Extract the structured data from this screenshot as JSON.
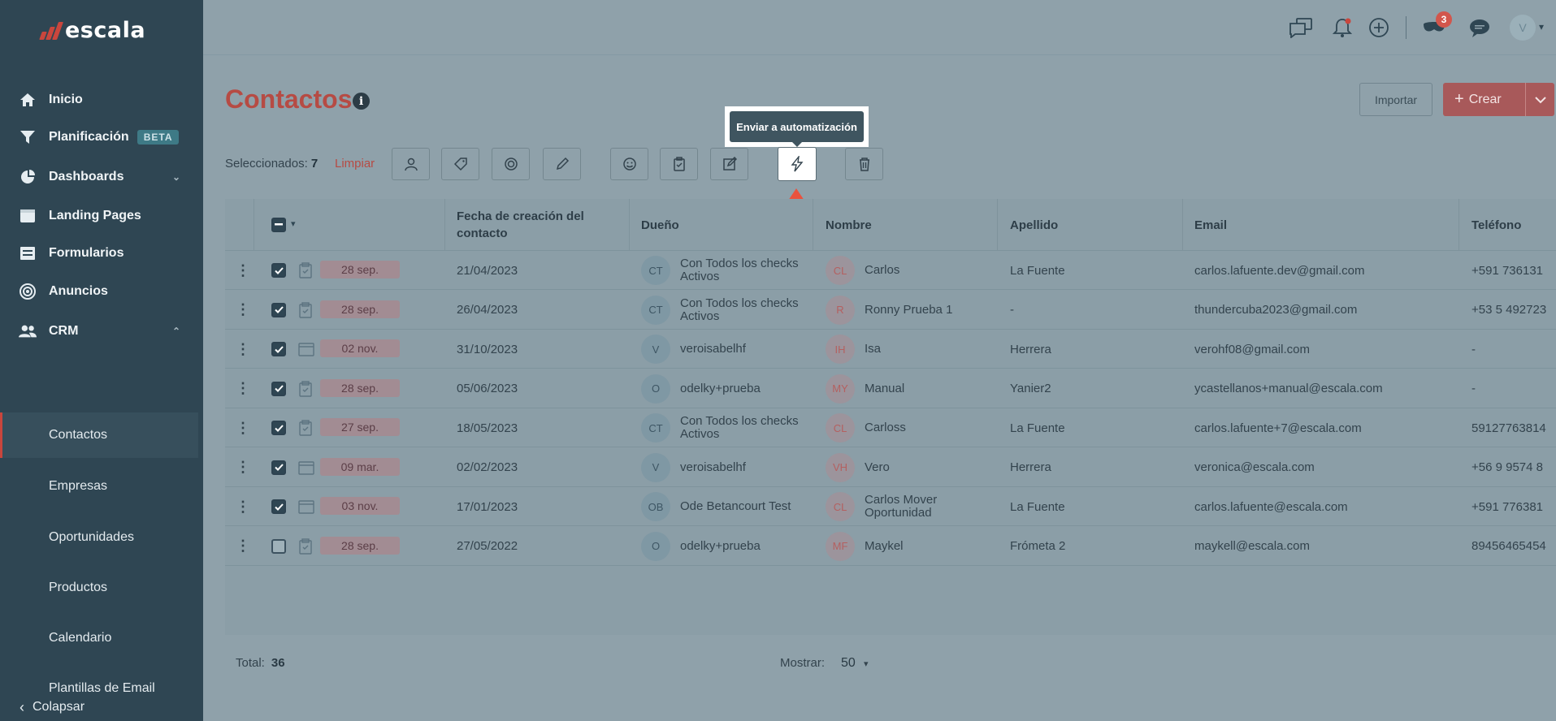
{
  "app": {
    "logo": "escala",
    "brand_color": "#c9463d"
  },
  "sidebar": {
    "items": [
      {
        "label": "Inicio",
        "icon": "home-icon"
      },
      {
        "label": "Planificación",
        "icon": "filter-icon",
        "badge": "BETA"
      },
      {
        "label": "Dashboards",
        "icon": "pie-chart-icon"
      },
      {
        "label": "Landing Pages",
        "icon": "browser-icon"
      },
      {
        "label": "Formularios",
        "icon": "form-icon"
      },
      {
        "label": "Anuncios",
        "icon": "target-icon"
      },
      {
        "label": "CRM",
        "icon": "users-icon"
      }
    ],
    "crm_subitems": [
      "Contactos",
      "Empresas",
      "Oportunidades",
      "Productos",
      "Calendario",
      "Plantillas de Email"
    ],
    "collapse_label": "Colapsar"
  },
  "topbar": {
    "notifications_badge": "3",
    "avatar_initial": "V"
  },
  "page": {
    "title": "Contactos",
    "import_label": "Importar",
    "create_label": "Crear"
  },
  "selection": {
    "label": "Seleccionados:",
    "count": "7",
    "clear_label": "Limpiar",
    "tooltip": "Enviar a automatización"
  },
  "table": {
    "headers": [
      "Fecha de creación del contacto",
      "Dueño",
      "Nombre",
      "Apellido",
      "Email",
      "Teléfono"
    ],
    "rows": [
      {
        "checked": true,
        "task": "clipboard-icon",
        "date": "28 sep.",
        "created": "21/04/2023",
        "owner_initials": "CT",
        "owner": "Con Todos los checks Activos",
        "name_initials": "CL",
        "name": "Carlos",
        "last": "La Fuente",
        "email": "carlos.lafuente.dev@gmail.com",
        "phone": "+591 736131"
      },
      {
        "checked": true,
        "task": "clipboard-icon",
        "date": "28 sep.",
        "created": "26/04/2023",
        "owner_initials": "CT",
        "owner": "Con Todos los checks Activos",
        "name_initials": "R",
        "name": "Ronny Prueba 1",
        "last": "-",
        "email": "thundercuba2023@gmail.com",
        "phone": "+53 5 492723"
      },
      {
        "checked": true,
        "task": "calendar-icon",
        "date": "02 nov.",
        "created": "31/10/2023",
        "owner_initials": "V",
        "owner": "veroisabelhf",
        "name_initials": "IH",
        "name": "Isa",
        "last": "Herrera",
        "email": "verohf08@gmail.com",
        "phone": "-"
      },
      {
        "checked": true,
        "task": "clipboard-icon",
        "date": "28 sep.",
        "created": "05/06/2023",
        "owner_initials": "O",
        "owner": "odelky+prueba",
        "name_initials": "MY",
        "name": "Manual",
        "last": "Yanier2",
        "email": "ycastellanos+manual@escala.com",
        "phone": "-"
      },
      {
        "checked": true,
        "task": "clipboard-icon",
        "date": "27 sep.",
        "created": "18/05/2023",
        "owner_initials": "CT",
        "owner": "Con Todos los checks Activos",
        "name_initials": "CL",
        "name": "Carloss",
        "last": "La Fuente",
        "email": "carlos.lafuente+7@escala.com",
        "phone": "59127763814"
      },
      {
        "checked": true,
        "task": "calendar-icon",
        "date": "09 mar.",
        "created": "02/02/2023",
        "owner_initials": "V",
        "owner": "veroisabelhf",
        "name_initials": "VH",
        "name": "Vero",
        "last": "Herrera",
        "email": "veronica@escala.com",
        "phone": "+56 9 9574 8"
      },
      {
        "checked": true,
        "task": "calendar-icon",
        "date": "03 nov.",
        "created": "17/01/2023",
        "owner_initials": "OB",
        "owner": "Ode Betancourt Test",
        "name_initials": "CL",
        "name": "Carlos Mover Oportunidad",
        "last": "La Fuente",
        "email": "carlos.lafuente@escala.com",
        "phone": "+591 776381"
      },
      {
        "checked": false,
        "task": "clipboard-icon",
        "date": "28 sep.",
        "created": "27/05/2022",
        "owner_initials": "O",
        "owner": "odelky+prueba",
        "name_initials": "MF",
        "name": "Maykel",
        "last": "Frómeta 2",
        "email": "maykell@escala.com",
        "phone": "89456465454"
      }
    ]
  },
  "footer": {
    "total_label": "Total:",
    "total": "36",
    "show_label": "Mostrar:",
    "show_value": "50"
  }
}
